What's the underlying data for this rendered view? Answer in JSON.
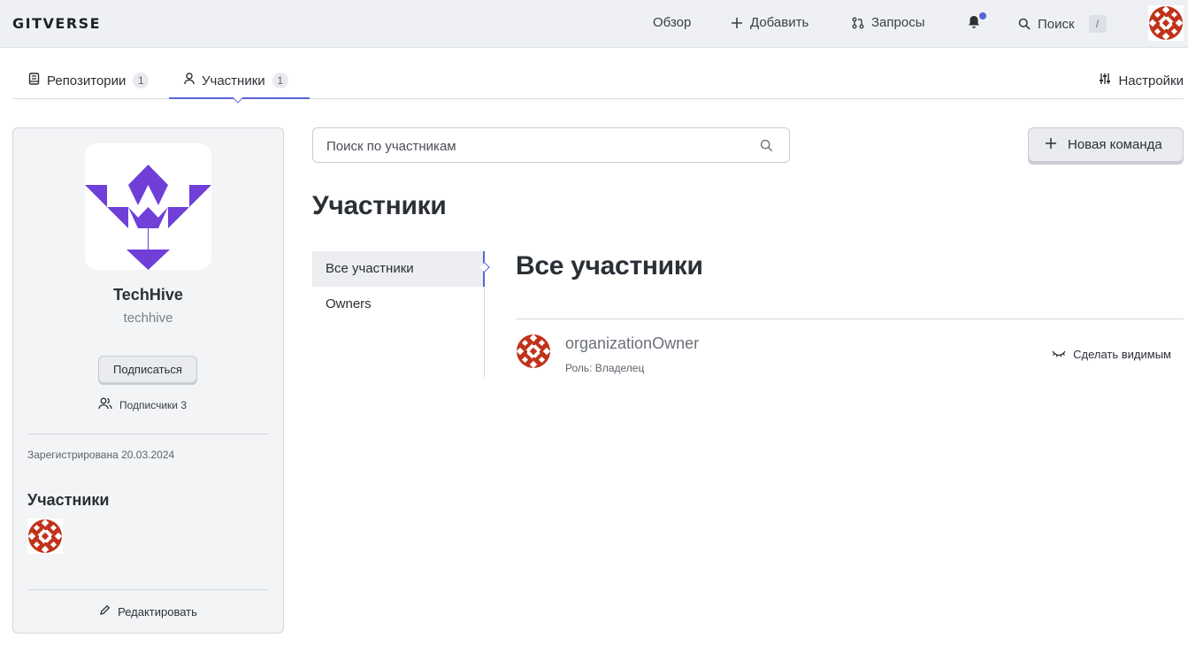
{
  "header": {
    "logo": "GITVERSE",
    "nav": {
      "overview": "Обзор",
      "add": "Добавить",
      "requests": "Запросы",
      "search": "Поиск",
      "search_shortcut": "/"
    },
    "has_notifications": true
  },
  "tabs": {
    "repositories": {
      "label": "Репозитории",
      "count": "1"
    },
    "members": {
      "label": "Участники",
      "count": "1"
    },
    "settings": "Настройки"
  },
  "org": {
    "name": "TechHive",
    "slug": "techhive",
    "follow_label": "Подписаться",
    "followers_label": "Подписчики 3",
    "registered": "Зарегистрирована 20.03.2024",
    "members_title": "Участники",
    "edit_label": "Редактировать"
  },
  "main": {
    "search_placeholder": "Поиск по участникам",
    "new_team_label": "Новая команда",
    "title": "Участники",
    "subnav": [
      "Все участники",
      "Owners"
    ],
    "section_title": "Все участники",
    "members": [
      {
        "name": "organizationOwner",
        "role": "Роль: Владелец",
        "action": "Сделать видимым"
      }
    ]
  },
  "colors": {
    "accent": "#5a63d8",
    "logo_purple": "#6f3fd8",
    "avatar_red": "#c0321a"
  }
}
